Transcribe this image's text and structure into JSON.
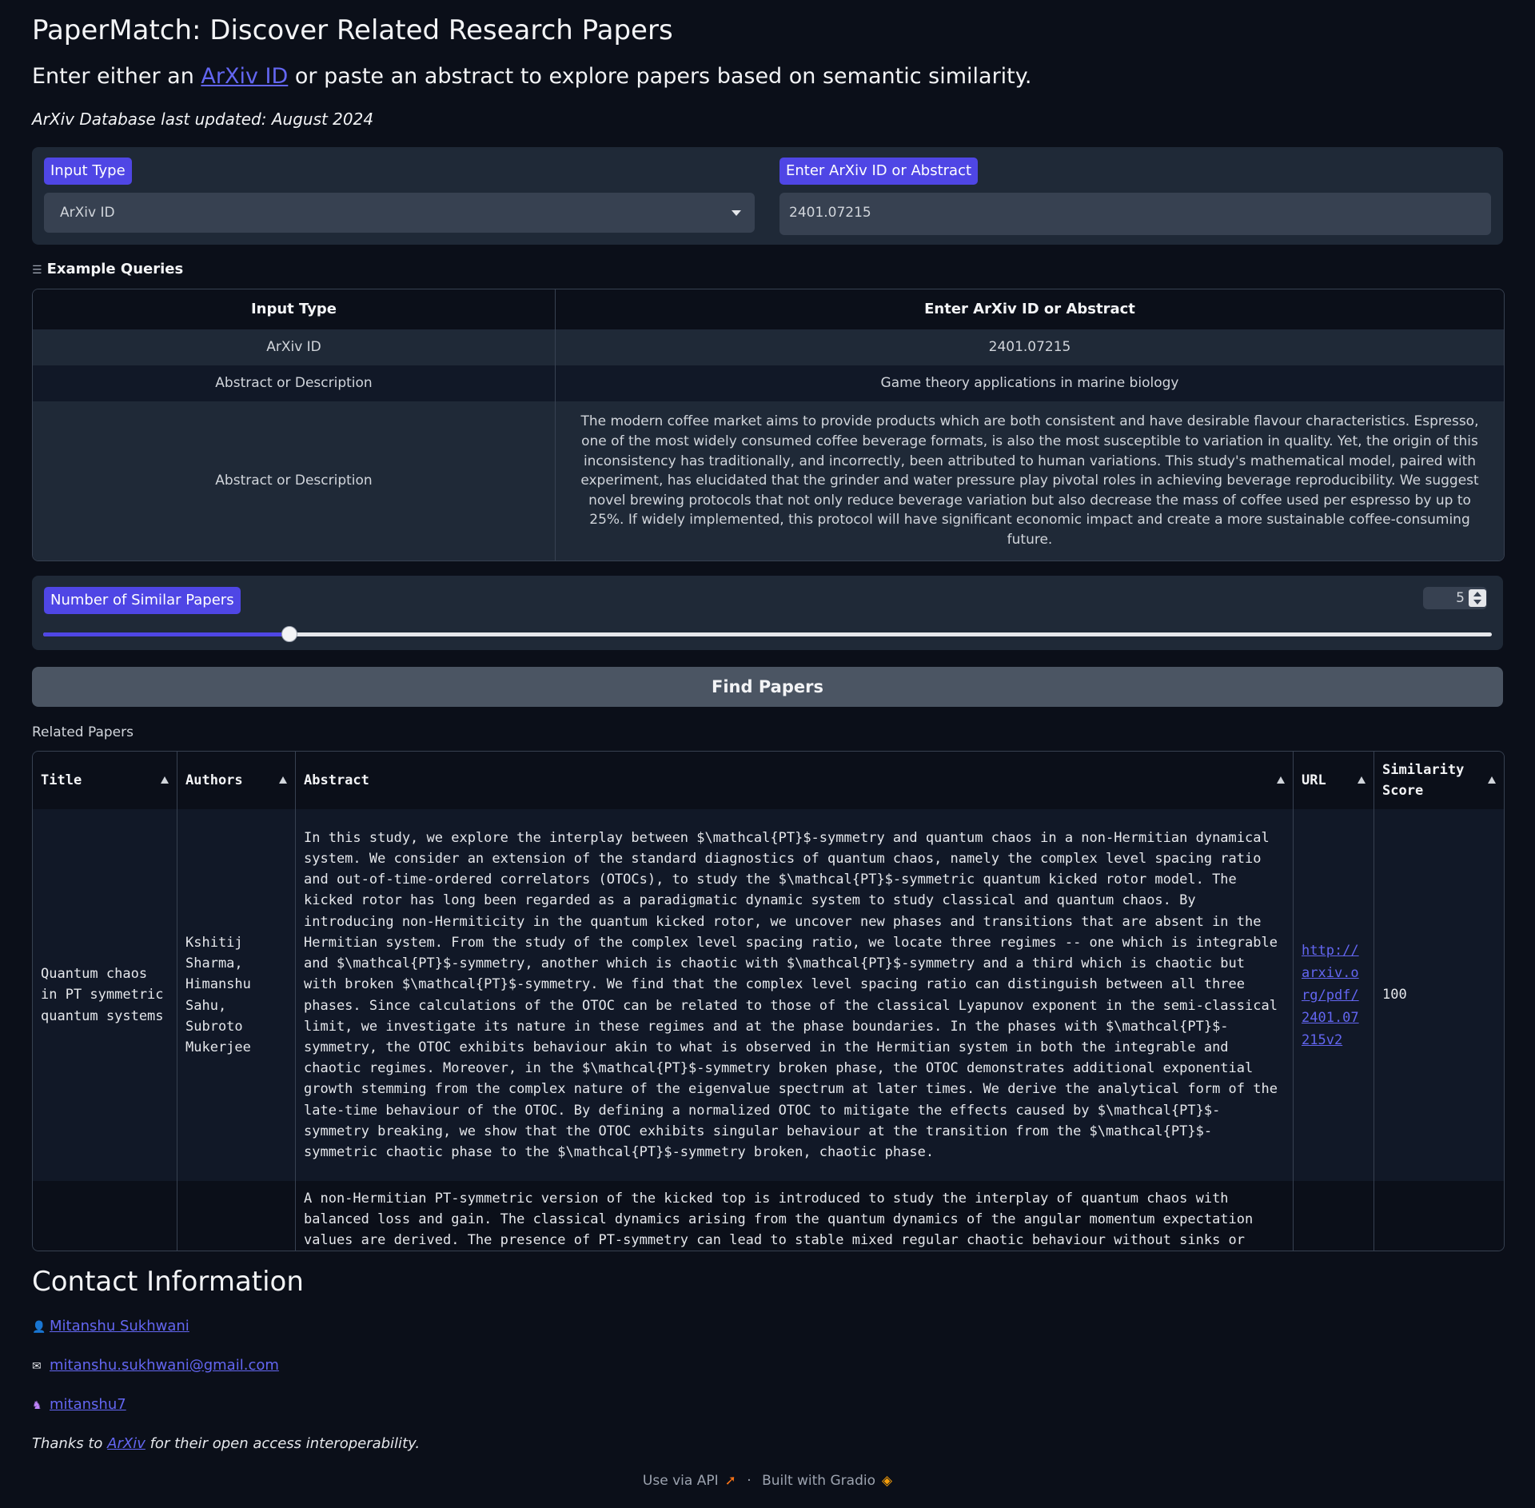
{
  "header": {
    "title": "PaperMatch: Discover Related Research Papers",
    "subtitle_pre": "Enter either an ",
    "subtitle_link": "ArXiv ID",
    "subtitle_post": " or paste an abstract to explore papers based on semantic similarity.",
    "updated": "ArXiv Database last updated: August 2024"
  },
  "inputs": {
    "input_type_label": "Input Type",
    "input_type_value": "ArXiv ID",
    "query_label": "Enter ArXiv ID or Abstract",
    "query_value": "2401.07215"
  },
  "examples": {
    "heading": "Example Queries",
    "columns": [
      "Input Type",
      "Enter ArXiv ID or Abstract"
    ],
    "rows": [
      [
        "ArXiv ID",
        "2401.07215"
      ],
      [
        "Abstract or Description",
        "Game theory applications in marine biology"
      ],
      [
        "Abstract or Description",
        "The modern coffee market aims to provide products which are both consistent and have desirable flavour characteristics. Espresso, one of the most widely consumed coffee beverage formats, is also the most susceptible to variation in quality. Yet, the origin of this inconsistency has traditionally, and incorrectly, been attributed to human variations. This study's mathematical model, paired with experiment, has elucidated that the grinder and water pressure play pivotal roles in achieving beverage reproducibility. We suggest novel brewing protocols that not only reduce beverage variation but also decrease the mass of coffee used per espresso by up to 25%. If widely implemented, this protocol will have significant economic impact and create a more sustainable coffee-consuming future."
      ]
    ]
  },
  "similar": {
    "label": "Number of Similar Papers",
    "value": "5",
    "slider_fraction": 0.17
  },
  "find_button": "Find Papers",
  "results": {
    "label": "Related Papers",
    "columns": [
      "Title",
      "Authors",
      "Abstract",
      "URL",
      "Similarity Score"
    ],
    "rows": [
      {
        "title": "Quantum chaos in PT symmetric quantum systems",
        "authors": "Kshitij Sharma, Himanshu Sahu, Subroto Mukerjee",
        "abstract": "In this study, we explore the interplay between $\\mathcal{PT}$-symmetry and quantum chaos in a non-Hermitian dynamical system. We consider an extension of the standard diagnostics of quantum chaos, namely the complex level spacing ratio and out-of-time-ordered correlators (OTOCs), to study the $\\mathcal{PT}$-symmetric quantum kicked rotor model. The kicked rotor has long been regarded as a paradigmatic dynamic system to study classical and quantum chaos. By introducing non-Hermiticity in the quantum kicked rotor, we uncover new phases and transitions that are absent in the Hermitian system. From the study of the complex level spacing ratio, we locate three regimes -- one which is integrable and $\\mathcal{PT}$-symmetry, another which is chaotic with $\\mathcal{PT}$-symmetry and a third which is chaotic but with broken $\\mathcal{PT}$-symmetry. We find that the complex level spacing ratio can distinguish between all three phases. Since calculations of the OTOC can be related to those of the classical Lyapunov exponent in the semi-classical limit, we investigate its nature in these regimes and at the phase boundaries. In the phases with $\\mathcal{PT}$-symmetry, the OTOC exhibits behaviour akin to what is observed in the Hermitian system in both the integrable and chaotic regimes. Moreover, in the $\\mathcal{PT}$-symmetry broken phase, the OTOC demonstrates additional exponential growth stemming from the complex nature of the eigenvalue spectrum at later times. We derive the analytical form of the late-time behaviour of the OTOC. By defining a normalized OTOC to mitigate the effects caused by $\\mathcal{PT}$-symmetry breaking, we show that the OTOC exhibits singular behaviour at the transition from the $\\mathcal{PT}$-symmetric chaotic phase to the $\\mathcal{PT}$-symmetry broken, chaotic phase.",
        "url": "http://arxiv.org/pdf/2401.07215v2",
        "score": "100"
      },
      {
        "title": "",
        "authors": "",
        "abstract": "A non-Hermitian PT-symmetric version of the kicked top is introduced to study the interplay of quantum chaos with balanced loss and gain. The classical dynamics arising from the quantum dynamics of the angular momentum expectation values are derived. The presence of PT-symmetry can lead to stable mixed regular chaotic behaviour without sinks or",
        "url": "",
        "score": ""
      }
    ]
  },
  "contact": {
    "heading": "Contact Information",
    "name": "Mitanshu Sukhwani",
    "email": "mitanshu.sukhwani@gmail.com",
    "github": "mitanshu7",
    "thanks_pre": "Thanks to ",
    "thanks_link": "ArXiv",
    "thanks_post": " for their open access interoperability."
  },
  "footer": {
    "api": "Use via API",
    "dot": "·",
    "built": "Built with Gradio"
  },
  "colors": {
    "background": "#0b0f19",
    "panel": "#1f2937",
    "accent": "#4f46e5",
    "link": "#6366f1"
  }
}
